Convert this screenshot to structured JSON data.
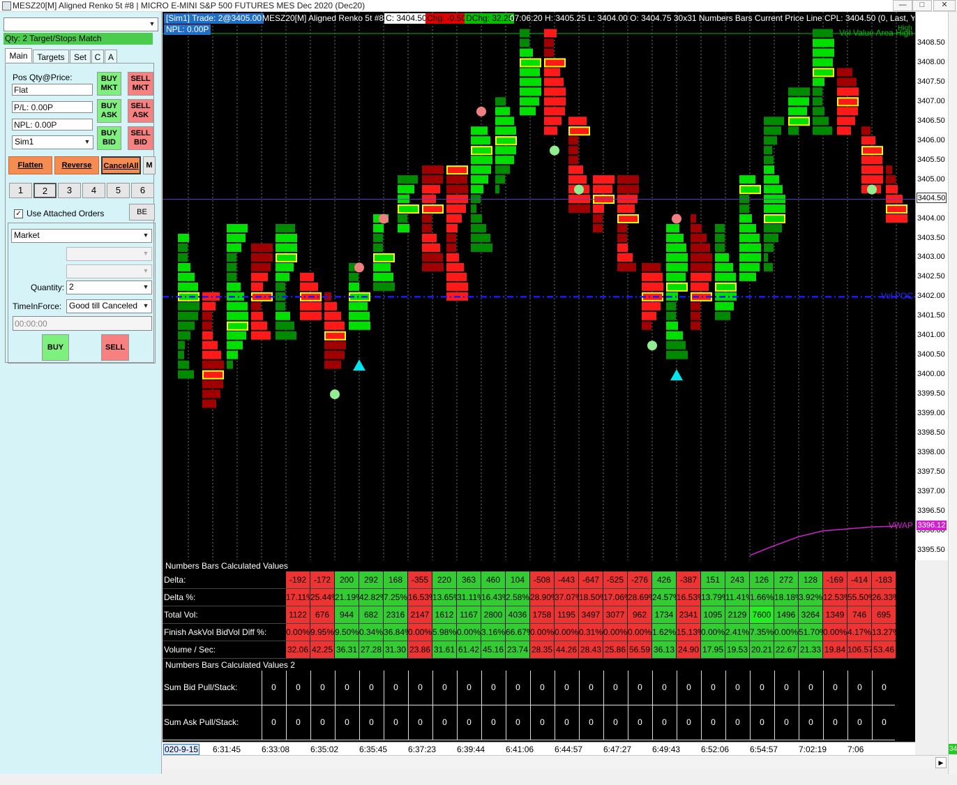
{
  "window": {
    "title": "MESZ20[M]  Aligned Renko 5t  #8 | MICRO E-MINI S&P 500 FUTURES MES Dec 2020 (Dec20)",
    "min_label": "—",
    "max_label": "□",
    "close_label": "✕"
  },
  "order_panel": {
    "status": "Qty: 2 Target/Stops Match",
    "tabs": [
      "Main",
      "Targets",
      "Set",
      "C",
      "A"
    ],
    "pos_label": "Pos Qty@Price:",
    "pos_value": "Flat",
    "pl_value": "P/L: 0.00P",
    "npl_value": "NPL: 0.00P",
    "account": "Sim1",
    "buy_mkt": [
      "BUY",
      "MKT"
    ],
    "sell_mkt": [
      "SELL",
      "MKT"
    ],
    "buy_ask": [
      "BUY",
      "ASK"
    ],
    "sell_ask": [
      "SELL",
      "ASK"
    ],
    "buy_bid": [
      "BUY",
      "BID"
    ],
    "sell_bid": [
      "SELL",
      "BID"
    ],
    "flatten": "Flatten",
    "reverse": "Reverse",
    "cancel_all": "CancelAll",
    "m_label": "M",
    "qty_presets": [
      "1",
      "2",
      "3",
      "4",
      "5",
      "6"
    ],
    "use_attached_label": "Use Attached Orders",
    "use_attached_checked": true,
    "be_label": "BE",
    "order_type": "Market",
    "quantity_label": "Quantity:",
    "quantity": "2",
    "tif_label": "TimeInForce:",
    "tif": "Good till Canceled",
    "time_value": "00:00:00",
    "buy": "BUY",
    "sell": "SELL"
  },
  "chart_header": {
    "account_trade": "[Sim1]  Trade: 2@3405.00",
    "symbol_desc": "MESZ20[M]  Aligned Renko 5t  #8",
    "close": "C: 3404.50",
    "chg": "Chg: -0.50",
    "dchg": "DChg: 32.25",
    "details": "07:06:20 H: 3405.25 L: 3404.00 O: 3404.75 30x31 Numbers Bars  Current Price Line  CPL: 3404.50   (0, Last, Yes, Ye",
    "npl": "NPL: 0.00P",
    "high_label": "High"
  },
  "chart_data": {
    "type": "table",
    "price_axis": {
      "min": 3395.0,
      "max": 3408.75,
      "ticks": [
        "3408.50",
        "3408.00",
        "3407.50",
        "3407.00",
        "3406.50",
        "3406.00",
        "3405.50",
        "3405.00",
        "3404.50",
        "3404.00",
        "3403.50",
        "3403.00",
        "3402.50",
        "3402.00",
        "3401.50",
        "3401.00",
        "3400.50",
        "3400.00",
        "3399.50",
        "3399.00",
        "3398.50",
        "3398.00",
        "3397.50",
        "3397.00",
        "3396.50",
        "3396.00",
        "3395.50"
      ],
      "current_price": "3404.50",
      "vwap_label": "3396.12"
    },
    "lines": {
      "vol_value_area_high": {
        "label": "Vol Value Area High",
        "price": 3408.75,
        "color": "#00c000"
      },
      "vol_poc": {
        "label": "Vol POC",
        "price": 3402.0,
        "color": "#1a1aff"
      },
      "current_price_line": {
        "price": 3404.5,
        "color": "#6a3bd1"
      },
      "vwap": {
        "label": "VWAP",
        "color": "#d020d0",
        "x": [
          23,
          24,
          25,
          26,
          27,
          28,
          29
        ],
        "y": [
          3395.37,
          3395.62,
          3395.85,
          3396.0,
          3396.05,
          3396.1,
          3396.12
        ]
      }
    },
    "bars": [
      {
        "open": 3402.0,
        "close": 3403.5,
        "high": 3403.5,
        "low": 3400.0,
        "dir": "up",
        "poc": 3402.0
      },
      {
        "open": 3402.0,
        "close": 3400.5,
        "high": 3402.0,
        "low": 3399.25,
        "dir": "down",
        "poc": 3400.0
      },
      {
        "open": 3400.5,
        "close": 3403.75,
        "high": 3403.75,
        "low": 3400.25,
        "dir": "up",
        "poc": 3401.25
      },
      {
        "open": 3402.5,
        "close": 3401.0,
        "high": 3403.25,
        "low": 3401.0,
        "dir": "down",
        "poc": 3402.0
      },
      {
        "open": 3401.5,
        "close": 3403.5,
        "high": 3403.75,
        "low": 3401.0,
        "dir": "up",
        "poc": 3403.0
      },
      {
        "open": 3402.5,
        "close": 3401.5,
        "high": 3402.5,
        "low": 3401.5,
        "dir": "down",
        "poc": 3402.0
      },
      {
        "open": 3401.75,
        "close": 3401.0,
        "high": 3402.0,
        "low": 3400.25,
        "dir": "down",
        "poc": 3401.0
      },
      {
        "open": 3401.25,
        "close": 3402.5,
        "high": 3402.75,
        "low": 3401.25,
        "dir": "up",
        "poc": 3402.0
      },
      {
        "open": 3402.5,
        "close": 3404.0,
        "high": 3404.0,
        "low": 3402.25,
        "dir": "up",
        "poc": 3403.0
      },
      {
        "open": 3403.5,
        "close": 3404.75,
        "high": 3405.0,
        "low": 3403.75,
        "dir": "up",
        "poc": 3404.25
      },
      {
        "open": 3404.75,
        "close": 3403.25,
        "high": 3405.25,
        "low": 3402.75,
        "dir": "down",
        "poc": 3404.25
      },
      {
        "open": 3404.5,
        "close": 3402.0,
        "high": 3405.0,
        "low": 3402.0,
        "dir": "down",
        "poc": 3405.25
      },
      {
        "open": 3404.5,
        "close": 3406.25,
        "high": 3406.25,
        "low": 3403.25,
        "dir": "up",
        "poc": 3405.75
      },
      {
        "open": 3405.5,
        "close": 3407.0,
        "high": 3407.0,
        "low": 3404.75,
        "dir": "up",
        "poc": 3406.0
      },
      {
        "open": 3406.5,
        "close": 3408.75,
        "high": 3408.75,
        "low": 3406.75,
        "dir": "up",
        "poc": 3408.0
      },
      {
        "open": 3408.75,
        "close": 3406.25,
        "high": 3408.75,
        "low": 3406.25,
        "dir": "down",
        "poc": 3408.0
      },
      {
        "open": 3406.5,
        "close": 3404.5,
        "high": 3406.5,
        "low": 3404.25,
        "dir": "down",
        "poc": 3406.25
      },
      {
        "open": 3405.0,
        "close": 3403.75,
        "high": 3405.0,
        "low": 3403.75,
        "dir": "down",
        "poc": 3404.5
      },
      {
        "open": 3404.5,
        "close": 3403.0,
        "high": 3405.0,
        "low": 3402.75,
        "dir": "down",
        "poc": 3404.0
      },
      {
        "open": 3402.5,
        "close": 3401.5,
        "high": 3402.75,
        "low": 3401.25,
        "dir": "down",
        "poc": 3402.0
      },
      {
        "open": 3401.0,
        "close": 3403.75,
        "high": 3403.75,
        "low": 3400.5,
        "dir": "up",
        "poc": 3402.25
      },
      {
        "open": 3402.5,
        "close": 3401.25,
        "high": 3404.0,
        "low": 3401.25,
        "dir": "down",
        "poc": 3402.0
      },
      {
        "open": 3401.75,
        "close": 3403.75,
        "high": 3403.75,
        "low": 3401.5,
        "dir": "up",
        "poc": 3402.25
      },
      {
        "open": 3402.5,
        "close": 3405.0,
        "high": 3405.0,
        "low": 3402.5,
        "dir": "up",
        "poc": 3404.75
      },
      {
        "open": 3404.0,
        "close": 3405.5,
        "high": 3406.5,
        "low": 3402.75,
        "dir": "up",
        "poc": 3404.0
      },
      {
        "open": 3405.25,
        "close": 3407.0,
        "high": 3407.25,
        "low": 3406.25,
        "dir": "up",
        "poc": 3406.5
      },
      {
        "open": 3407.0,
        "close": 3408.5,
        "high": 3408.75,
        "low": 3406.25,
        "dir": "up",
        "poc": 3407.75
      },
      {
        "open": 3407.25,
        "close": 3406.25,
        "high": 3407.75,
        "low": 3406.25,
        "dir": "down",
        "poc": 3407.0
      },
      {
        "open": 3406.0,
        "close": 3404.75,
        "high": 3406.25,
        "low": 3404.75,
        "dir": "down",
        "poc": 3405.75
      },
      {
        "open": 3405.0,
        "close": 3404.0,
        "high": 3405.25,
        "low": 3404.0,
        "dir": "down",
        "poc": 3404.25
      }
    ],
    "signals": [
      {
        "bar": 6,
        "price": 3399.5,
        "type": "dot",
        "color": "#90ee90"
      },
      {
        "bar": 7,
        "price": 3402.75,
        "type": "dot",
        "color": "#f08080"
      },
      {
        "bar": 7,
        "price": 3400.25,
        "type": "triangle",
        "color": "#00e5ee"
      },
      {
        "bar": 8,
        "price": 3404.0,
        "type": "dot",
        "color": "#f08080"
      },
      {
        "bar": 12,
        "price": 3406.75,
        "type": "dot",
        "color": "#f08080"
      },
      {
        "bar": 15,
        "price": 3405.75,
        "type": "dot",
        "color": "#90ee90"
      },
      {
        "bar": 16,
        "price": 3404.75,
        "type": "dot",
        "color": "#90ee90"
      },
      {
        "bar": 19,
        "price": 3400.75,
        "type": "dot",
        "color": "#90ee90"
      },
      {
        "bar": 20,
        "price": 3404.0,
        "type": "dot",
        "color": "#f08080"
      },
      {
        "bar": 20,
        "price": 3400.0,
        "type": "triangle",
        "color": "#00e5ee"
      },
      {
        "bar": 28,
        "price": 3404.75,
        "type": "dot",
        "color": "#90ee90"
      }
    ]
  },
  "numbers_bars": {
    "title": "Numbers Bars Calculated Values",
    "rows": [
      {
        "label": "Delta:",
        "values": [
          "-192",
          "-172",
          "200",
          "292",
          "168",
          "-355",
          "220",
          "363",
          "460",
          "104",
          "-508",
          "-443",
          "-647",
          "-525",
          "-276",
          "426",
          "-387",
          "151",
          "243",
          "126",
          "272",
          "128",
          "-169",
          "-414",
          "-183"
        ]
      },
      {
        "label": "Delta %:",
        "values": [
          "17.11%",
          "25.44%",
          "21.19%",
          "42.82%",
          "7.25%",
          "16.53%",
          "13.65%",
          "31.11%",
          "16.43%",
          "2.58%",
          "28.90%",
          "37.07%",
          "18.50%",
          "17.06%",
          "28.69%",
          "24.57%",
          "16.53%",
          "13.79%",
          "11.41%",
          "1.66%",
          "18.18%",
          "3.92%",
          "12.53%",
          "55.50%",
          "26.33%"
        ]
      },
      {
        "label": "Total Vol:",
        "values": [
          "1122",
          "676",
          "944",
          "682",
          "2316",
          "2147",
          "1612",
          "1167",
          "2800",
          "4036",
          "1758",
          "1195",
          "3497",
          "3077",
          "962",
          "1734",
          "2341",
          "1095",
          "2129",
          "7600",
          "1496",
          "3264",
          "1349",
          "746",
          "695"
        ]
      },
      {
        "label": "Finish AskVol BidVol Diff %:",
        "values": [
          "0.00%",
          "9.95%",
          "9.50%",
          "0.34%",
          "36.84%",
          "0.00%",
          "5.98%",
          "0.00%",
          "3.16%",
          "66.67%",
          "0.00%",
          "0.00%",
          "0.31%",
          "0.00%",
          "0.00%",
          "1.62%",
          "15.13%",
          "0.00%",
          "2.41%",
          "7.35%",
          "0.00%",
          "51.70%",
          "0.00%",
          "4.17%",
          "13.27%"
        ]
      },
      {
        "label": "Volume / Sec:",
        "values": [
          "32.06",
          "42.25",
          "36.31",
          "27.28",
          "31.30",
          "23.86",
          "31.61",
          "61.42",
          "45.16",
          "23.74",
          "28.35",
          "44.26",
          "28.43",
          "25.86",
          "56.59",
          "36.13",
          "24.90",
          "17.95",
          "19.53",
          "20.21",
          "22.67",
          "21.33",
          "19.84",
          "106.57",
          "53.46"
        ]
      }
    ],
    "title2": "Numbers Bars Calculated Values 2",
    "rows2": [
      {
        "label": "Sum Bid Pull/Stack:",
        "values": [
          "0",
          "0",
          "0",
          "0",
          "0",
          "0",
          "0",
          "0",
          "0",
          "0",
          "0",
          "0",
          "0",
          "0",
          "0",
          "0",
          "0",
          "0",
          "0",
          "0",
          "0",
          "0",
          "0",
          "0",
          "0",
          "0"
        ]
      },
      {
        "label": "Sum Ask Pull/Stack:",
        "values": [
          "0",
          "0",
          "0",
          "0",
          "0",
          "0",
          "0",
          "0",
          "0",
          "0",
          "0",
          "0",
          "0",
          "0",
          "0",
          "0",
          "0",
          "0",
          "0",
          "0",
          "0",
          "0",
          "0",
          "0",
          "0",
          "0"
        ]
      }
    ]
  },
  "time_axis": {
    "first": "020-9-15",
    "labels": [
      "6:31:45",
      "6:33:08",
      "6:35:02",
      "6:35:45",
      "6:37:23",
      "6:39:44",
      "6:41:06",
      "6:44:57",
      "6:47:27",
      "6:49:43",
      "6:52:06",
      "6:54:57",
      "7:02:19",
      "7:06"
    ]
  },
  "status_badge": "34",
  "colors": {
    "up_strong": "#00e000",
    "up_dark": "#008a00",
    "down_strong": "#ff1a1a",
    "down_dark": "#a00000",
    "poc_box": "#ffff00",
    "positive_cell": "#33cc33",
    "negative_cell": "#ee3333"
  }
}
